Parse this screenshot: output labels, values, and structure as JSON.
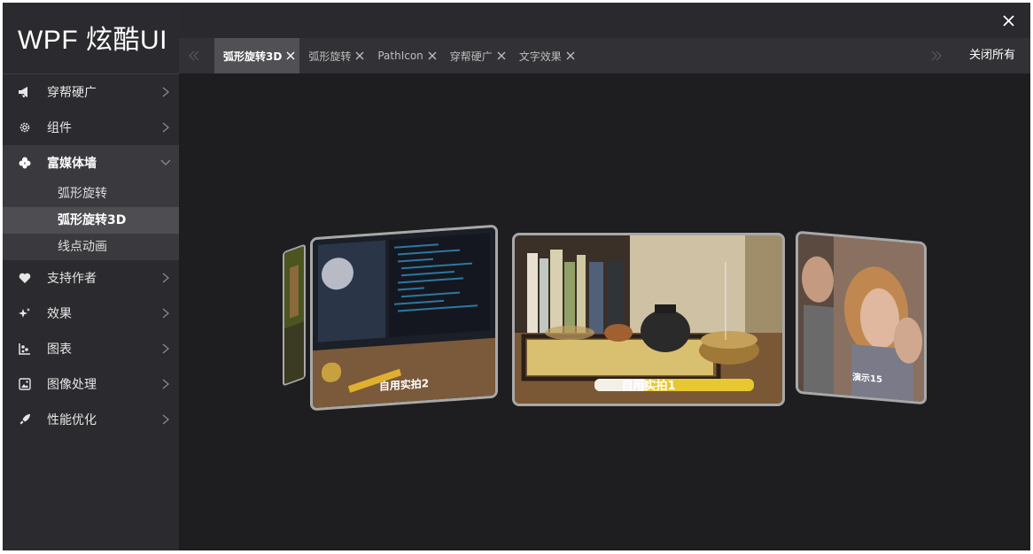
{
  "app": {
    "title": "WPF 炫酷UI"
  },
  "menu": [
    {
      "label": "穿帮硬广",
      "icon": "megaphone-icon"
    },
    {
      "label": "组件",
      "icon": "gear-icon"
    },
    {
      "label": "富媒体墙",
      "icon": "clover-icon",
      "expanded": true,
      "children": [
        {
          "label": "弧形旋转"
        },
        {
          "label": "弧形旋转3D",
          "active": true
        },
        {
          "label": "线点动画"
        }
      ]
    },
    {
      "label": "支持作者",
      "icon": "heart-icon"
    },
    {
      "label": "效果",
      "icon": "sparkle-icon"
    },
    {
      "label": "图表",
      "icon": "chart-icon"
    },
    {
      "label": "图像处理",
      "icon": "image-icon"
    },
    {
      "label": "性能优化",
      "icon": "rocket-icon"
    }
  ],
  "tabs": [
    {
      "label": "弧形旋转3D",
      "active": true
    },
    {
      "label": "弧形旋转"
    },
    {
      "label": "PathIcon"
    },
    {
      "label": "穿帮硬广"
    },
    {
      "label": "文字效果"
    }
  ],
  "toolbar": {
    "close_all": "关闭所有"
  },
  "carousel": [
    {
      "caption": ""
    },
    {
      "caption": "自用实拍2"
    },
    {
      "caption": "自用实拍1"
    },
    {
      "caption": "演示15"
    }
  ],
  "colors": {
    "sidebar": "#2b2b2f",
    "content": "#1e1e20",
    "active_tab": "#505055"
  }
}
